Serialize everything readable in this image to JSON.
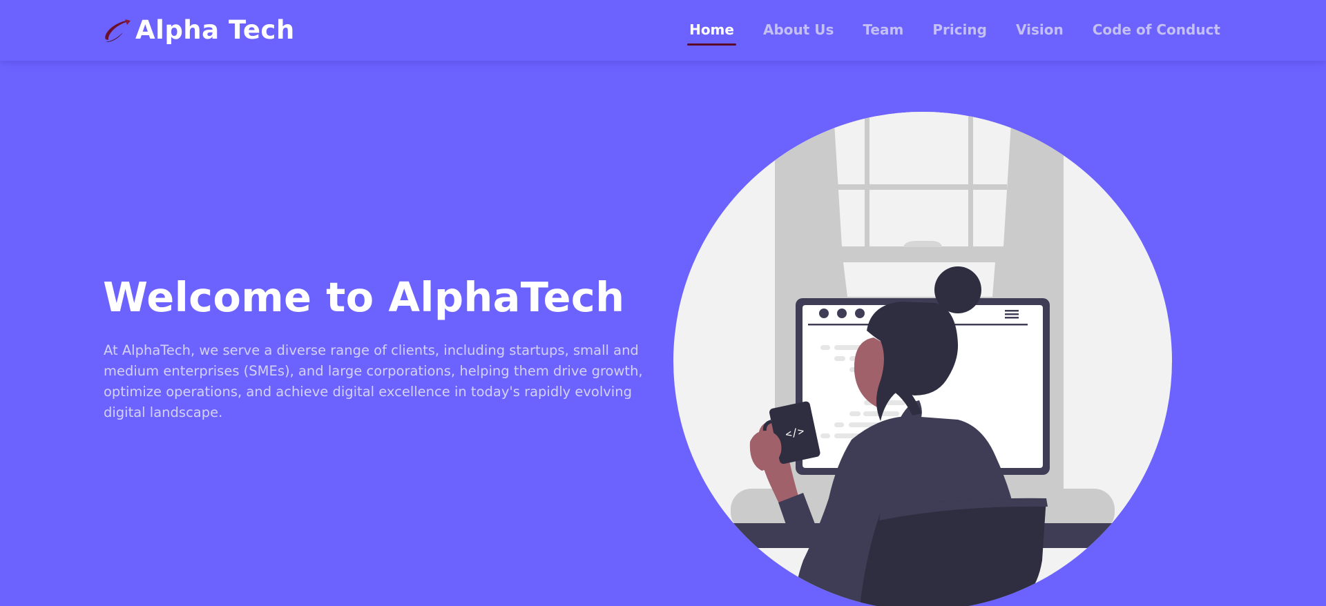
{
  "brand": {
    "name": "Alpha Tech",
    "logo_icon": "orbit-swoosh-icon",
    "logo_color": "#6b0f2a"
  },
  "nav": {
    "items": [
      {
        "label": "Home",
        "active": true
      },
      {
        "label": "About Us",
        "active": false
      },
      {
        "label": "Team",
        "active": false
      },
      {
        "label": "Pricing",
        "active": false
      },
      {
        "label": "Vision",
        "active": false
      },
      {
        "label": "Code of Conduct",
        "active": false
      }
    ]
  },
  "hero": {
    "title": "Welcome to AlphaTech",
    "description": "At AlphaTech, we serve a diverse range of clients, including startups, small and medium enterprises (SMEs), and large corporations, helping them drive growth, optimize operations, and achieve digital excellence in today's rapidly evolving digital landscape.",
    "illustration_icon": "developer-at-computer-illustration",
    "mug_label": "</>"
  },
  "colors": {
    "background": "#6c63ff",
    "nav_text": "#c4c0f3",
    "nav_active": "#ffffff",
    "nav_underline": "#5a0a26",
    "hero_text": "#d4d1f6",
    "illustration_circle": "#f2f2f2",
    "illustration_dark": "#2f2e41"
  }
}
